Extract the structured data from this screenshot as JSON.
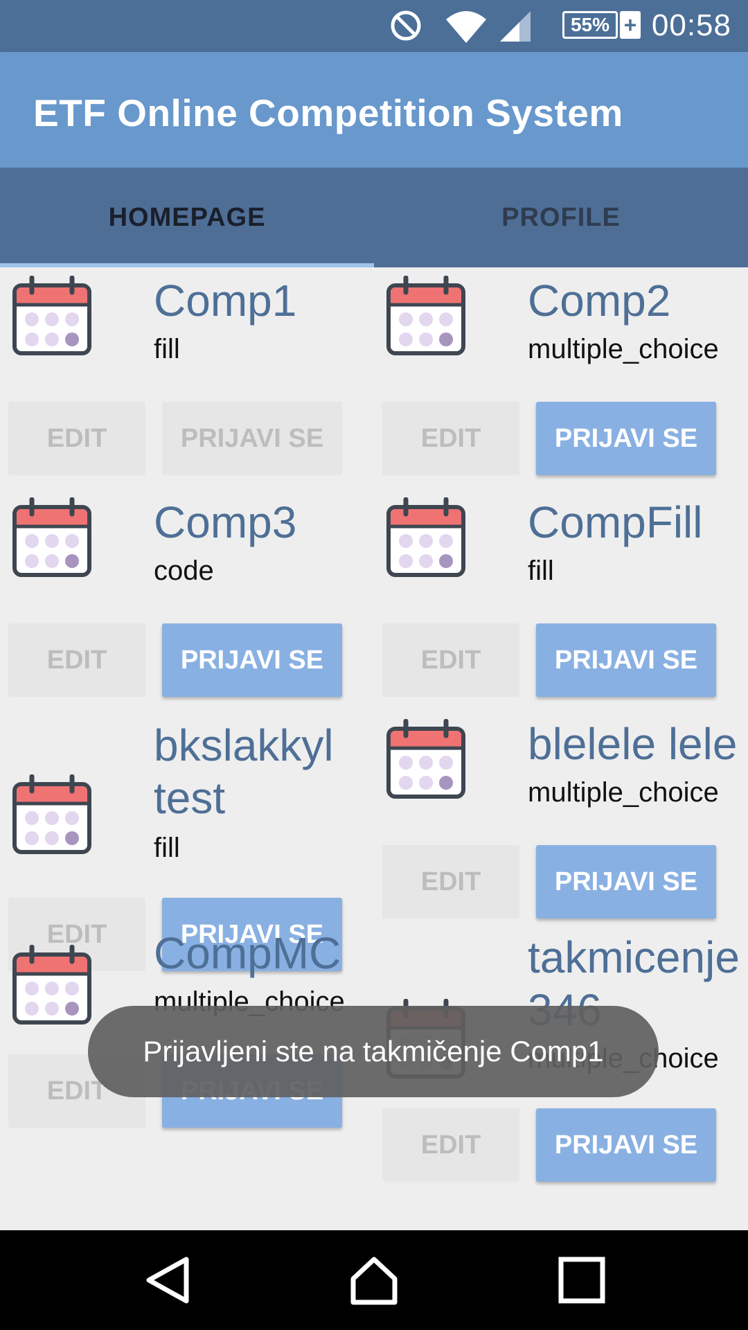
{
  "status_bar": {
    "battery": "55%",
    "time": "00:58",
    "icons": [
      "do-not-disturb-icon",
      "wifi-icon",
      "signal-icon",
      "battery-charging-icon"
    ]
  },
  "app": {
    "title": "ETF Online Competition System"
  },
  "tabs": {
    "home": "HOMEPAGE",
    "profile": "PROFILE",
    "selected": "HOMEPAGE"
  },
  "competitions": [
    {
      "name": "Comp1",
      "type": "fill",
      "edit_label": "EDIT",
      "apply_label": "PRIJAVI SE",
      "apply_enabled": false
    },
    {
      "name": "Comp2",
      "type": "multiple_choice",
      "edit_label": "EDIT",
      "apply_label": "PRIJAVI SE",
      "apply_enabled": true
    },
    {
      "name": "Comp3",
      "type": "code",
      "edit_label": "EDIT",
      "apply_label": "PRIJAVI SE",
      "apply_enabled": true
    },
    {
      "name": "CompFill",
      "type": "fill",
      "edit_label": "EDIT",
      "apply_label": "PRIJAVI SE",
      "apply_enabled": true
    },
    {
      "name": "bkslakkyl test",
      "type": "fill",
      "edit_label": "EDIT",
      "apply_label": "PRIJAVI SE",
      "apply_enabled": true
    },
    {
      "name": "blelele lele",
      "type": "multiple_choice",
      "edit_label": "EDIT",
      "apply_label": "PRIJAVI SE",
      "apply_enabled": true
    },
    {
      "name": "CompMC",
      "type": "multiple_choice",
      "edit_label": "EDIT",
      "apply_label": "PRIJAVI SE",
      "apply_enabled": true
    },
    {
      "name": "takmicenje346",
      "type": "multiple_choice",
      "edit_label": "EDIT",
      "apply_label": "PRIJAVI SE",
      "apply_enabled": true
    }
  ],
  "toast": {
    "message": "Prijavljeni ste na takmičenje Comp1"
  },
  "nav": {
    "icons": [
      "back-icon",
      "home-icon",
      "recents-icon"
    ]
  },
  "colors": {
    "status_bar": "#4c6f98",
    "app_bar": "#6898cc",
    "tab_bar": "#4e6e96",
    "accent_button": "#89b0e2",
    "competition_name": "#4e6f96"
  }
}
